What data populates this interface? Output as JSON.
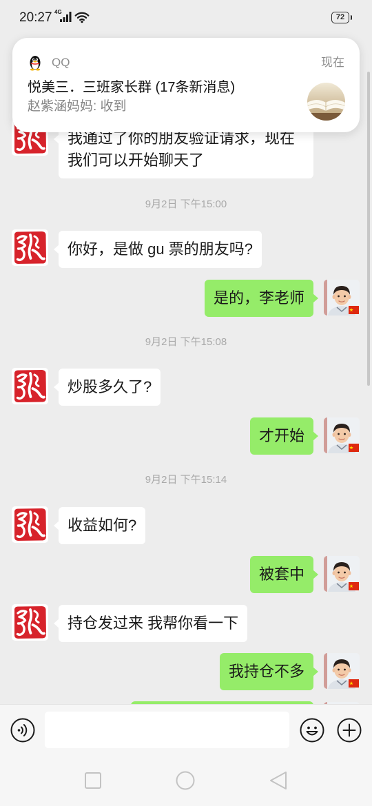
{
  "status_bar": {
    "time": "20:27",
    "network_label": "4G",
    "battery_level": "72",
    "icons": {
      "signal": "signal-icon",
      "wifi": "wifi-icon",
      "battery": "battery-icon"
    }
  },
  "notification": {
    "app_icon": "qq-penguin-icon",
    "app_name": "QQ",
    "time": "现在",
    "title": "悦美三．三班家长群 (17条新消息)",
    "message": "赵紫涵妈妈: 收到",
    "thumbnail_icon": "open-book-photo-thumbnail"
  },
  "chat": {
    "contact_avatar_icon": "red-calligraphy-logo-avatar",
    "self_avatar_icon": "child-photo-avatar",
    "items": [
      {
        "outgoing": false,
        "lines": [
          "我通过了你的朋友验证请求，现在",
          "我们可以开始聊天了"
        ]
      },
      {
        "time_label": "9月2日 下午15:00"
      },
      {
        "outgoing": false,
        "text": "你好，是做 gu 票的朋友吗?"
      },
      {
        "outgoing": true,
        "text": "是的，李老师"
      },
      {
        "time_label": "9月2日 下午15:08"
      },
      {
        "outgoing": false,
        "text": "炒股多久了?"
      },
      {
        "outgoing": true,
        "text": "才开始"
      },
      {
        "time_label": "9月2日 下午15:14"
      },
      {
        "outgoing": false,
        "text": "收益如何?"
      },
      {
        "outgoing": true,
        "text": "被套中"
      },
      {
        "outgoing": false,
        "text": "持仓发过来 我帮你看一下"
      },
      {
        "outgoing": true,
        "text": "我持仓不多"
      },
      {
        "outgoing": true
      }
    ]
  },
  "input_bar": {
    "voice_icon": "voice-input-icon",
    "value": "",
    "emoji_icon": "emoji-icon",
    "more_icon": "plus-icon"
  },
  "nav_bar": {
    "recents_icon": "square-recents-icon",
    "home_icon": "circle-home-icon",
    "back_icon": "triangle-back-icon"
  },
  "colors": {
    "chat_background": "#ededed",
    "outgoing_bubble": "#95ec69",
    "incoming_bubble": "#ffffff",
    "timestamp_text": "#a9a9a9",
    "bar_background": "#f6f6f6",
    "notification_background": "#ffffff",
    "logo_red": "#d7232b"
  }
}
